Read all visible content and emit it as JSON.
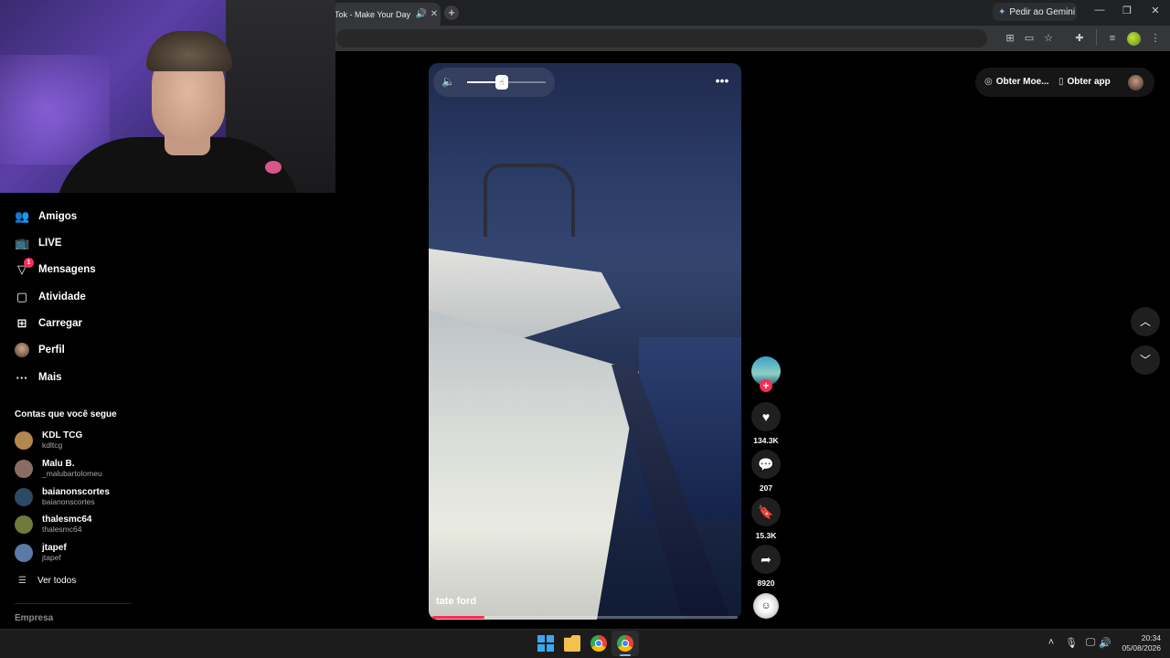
{
  "browser": {
    "tab_title": "Tok - Make Your Day",
    "tab_audio_icon": "speaker-icon",
    "tab_close": "✕",
    "new_tab": "+",
    "gemini_label": "Pedir ao Gemini",
    "window_min": "—",
    "window_restore": "❐",
    "window_close": "✕"
  },
  "sidebar": {
    "items": [
      {
        "label": "Amigos",
        "icon": "users-icon"
      },
      {
        "label": "LIVE",
        "icon": "live-tv-icon"
      },
      {
        "label": "Mensagens",
        "icon": "send-icon",
        "badge": "1"
      },
      {
        "label": "Atividade",
        "icon": "activity-icon"
      },
      {
        "label": "Carregar",
        "icon": "upload-icon"
      },
      {
        "label": "Perfil",
        "icon": "avatar"
      },
      {
        "label": "Mais",
        "icon": "more-icon"
      }
    ],
    "following_title": "Contas que você segue",
    "accounts": [
      {
        "name": "KDL TCG",
        "handle": "kdltcg",
        "color": "#b3874f"
      },
      {
        "name": "Malu B.",
        "handle": "_malubartolomeu",
        "color": "#8a6d62"
      },
      {
        "name": "baianonscortes",
        "handle": "baianonscortes",
        "color": "#2b4a63"
      },
      {
        "name": "thalesmc64",
        "handle": "thalesmc64",
        "color": "#6f7a3a"
      },
      {
        "name": "jtapef",
        "handle": "jtapef",
        "color": "#5a7aa8"
      }
    ],
    "see_all": "Ver todos",
    "company": "Empresa"
  },
  "video": {
    "author": "tate ford",
    "volume_level": 0.44,
    "progress": 0.17
  },
  "actions": {
    "likes": "134.3K",
    "comments": "207",
    "saves": "15.3K",
    "shares": "8920"
  },
  "top_right": {
    "coins": "Obter Moe...",
    "get_app": "Obter app"
  },
  "taskbar": {
    "time": "20:34",
    "date": "05/08/2026"
  },
  "colors": {
    "accent": "#fe2c55",
    "background": "#000000"
  }
}
